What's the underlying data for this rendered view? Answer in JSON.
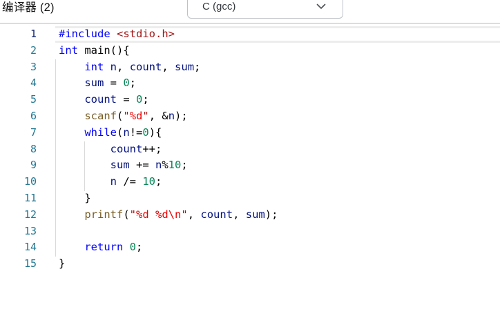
{
  "header": {
    "title": "编译器 (2)",
    "language_dropdown": {
      "value": "C (gcc)",
      "chevron_icon": "chevron-down-icon"
    }
  },
  "editor": {
    "language": "C",
    "active_line": 1,
    "colors": {
      "keyword": "#0000ff",
      "string": "#a31515",
      "format_specifier": "#ee0000",
      "number": "#098658",
      "variable": "#001080",
      "function": "#795e26",
      "plain": "#000000",
      "line_number": "#237893",
      "active_line_number": "#0b216f",
      "indent_guide": "#d9d9d9",
      "active_line_border": "#ededed"
    },
    "lines": [
      {
        "num": 1,
        "tokens": [
          [
            "kw",
            "#include"
          ],
          [
            "plain",
            " "
          ],
          [
            "str",
            "<stdio.h>"
          ]
        ]
      },
      {
        "num": 2,
        "tokens": [
          [
            "kw",
            "int"
          ],
          [
            "plain",
            " main(){"
          ]
        ]
      },
      {
        "num": 3,
        "tokens": [
          [
            "plain",
            "    "
          ],
          [
            "kw",
            "int"
          ],
          [
            "plain",
            " "
          ],
          [
            "var",
            "n"
          ],
          [
            "plain",
            ", "
          ],
          [
            "var",
            "count"
          ],
          [
            "plain",
            ", "
          ],
          [
            "var",
            "sum"
          ],
          [
            "plain",
            ";"
          ]
        ]
      },
      {
        "num": 4,
        "tokens": [
          [
            "plain",
            "    "
          ],
          [
            "var",
            "sum"
          ],
          [
            "plain",
            " = "
          ],
          [
            "num",
            "0"
          ],
          [
            "plain",
            ";"
          ]
        ]
      },
      {
        "num": 5,
        "tokens": [
          [
            "plain",
            "    "
          ],
          [
            "var",
            "count"
          ],
          [
            "plain",
            " = "
          ],
          [
            "num",
            "0"
          ],
          [
            "plain",
            ";"
          ]
        ]
      },
      {
        "num": 6,
        "tokens": [
          [
            "plain",
            "    "
          ],
          [
            "fn",
            "scanf"
          ],
          [
            "plain",
            "("
          ],
          [
            "str",
            "\""
          ],
          [
            "fmt",
            "%d"
          ],
          [
            "str",
            "\""
          ],
          [
            "plain",
            ", &"
          ],
          [
            "var",
            "n"
          ],
          [
            "plain",
            ");"
          ]
        ]
      },
      {
        "num": 7,
        "tokens": [
          [
            "plain",
            "    "
          ],
          [
            "kw",
            "while"
          ],
          [
            "plain",
            "("
          ],
          [
            "var",
            "n"
          ],
          [
            "plain",
            "!="
          ],
          [
            "num",
            "0"
          ],
          [
            "plain",
            "){"
          ]
        ]
      },
      {
        "num": 8,
        "tokens": [
          [
            "plain",
            "        "
          ],
          [
            "var",
            "count"
          ],
          [
            "plain",
            "++;"
          ]
        ]
      },
      {
        "num": 9,
        "tokens": [
          [
            "plain",
            "        "
          ],
          [
            "var",
            "sum"
          ],
          [
            "plain",
            " += "
          ],
          [
            "var",
            "n"
          ],
          [
            "plain",
            "%"
          ],
          [
            "num",
            "10"
          ],
          [
            "plain",
            ";"
          ]
        ]
      },
      {
        "num": 10,
        "tokens": [
          [
            "plain",
            "        "
          ],
          [
            "var",
            "n"
          ],
          [
            "plain",
            " /= "
          ],
          [
            "num",
            "10"
          ],
          [
            "plain",
            ";"
          ]
        ]
      },
      {
        "num": 11,
        "tokens": [
          [
            "plain",
            "    }"
          ]
        ]
      },
      {
        "num": 12,
        "tokens": [
          [
            "plain",
            "    "
          ],
          [
            "fn",
            "printf"
          ],
          [
            "plain",
            "("
          ],
          [
            "str",
            "\""
          ],
          [
            "fmt",
            "%d"
          ],
          [
            "str",
            " "
          ],
          [
            "fmt",
            "%d"
          ],
          [
            "fmt",
            "\\n"
          ],
          [
            "str",
            "\""
          ],
          [
            "plain",
            ", "
          ],
          [
            "var",
            "count"
          ],
          [
            "plain",
            ", "
          ],
          [
            "var",
            "sum"
          ],
          [
            "plain",
            ");"
          ]
        ]
      },
      {
        "num": 13,
        "tokens": []
      },
      {
        "num": 14,
        "tokens": [
          [
            "plain",
            "    "
          ],
          [
            "kw",
            "return"
          ],
          [
            "plain",
            " "
          ],
          [
            "num",
            "0"
          ],
          [
            "plain",
            ";"
          ]
        ]
      },
      {
        "num": 15,
        "tokens": [
          [
            "plain",
            "}"
          ]
        ]
      }
    ]
  }
}
